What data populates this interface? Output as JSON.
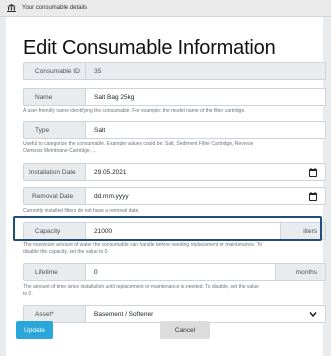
{
  "header": {
    "title": "Your consumable details",
    "icon": "bank-icon"
  },
  "form": {
    "title": "Edit Consumable Information",
    "id": {
      "label": "Consumable ID",
      "value": "35"
    },
    "name": {
      "label": "Name",
      "value": "Salt Bag 25kg",
      "help": "A user-friendly name identifying the consumable. For example: the model name of the filter cartridge."
    },
    "type": {
      "label": "Type",
      "value": "Salt",
      "help1": "Useful to categorize the consumable. Example values could be: Salt, Sediment Filter Cartridge, Reverse",
      "help2": "Osmosis Membrane Cartridge, ..."
    },
    "installation_date": {
      "label": "Installation Date",
      "value": "29.05.2021"
    },
    "removal_date": {
      "label": "Removal Date",
      "placeholder": "dd.mm.yyyy",
      "help": "Currently installed filters do not have a removal date."
    },
    "capacity": {
      "label": "Capacity",
      "value": "21000",
      "unit": "liters",
      "help1": "The maximum amount of water the consumable can handle before needing replacement or maintenance. To",
      "help2": "disable the capacity, set the value to 0."
    },
    "lifetime": {
      "label": "Lifetime",
      "value": "0",
      "unit": "months",
      "help1": "The amount of time since installation until replacement or maintenance is needed. To disable, set the value",
      "help2": "to 0."
    },
    "asset": {
      "label": "Asset*",
      "value": "Basement / Softener"
    },
    "update_label": "Update",
    "cancel_label": "Cancel"
  },
  "colors": {
    "accent": "#2aa6d9",
    "highlight": "#1f4e79"
  }
}
